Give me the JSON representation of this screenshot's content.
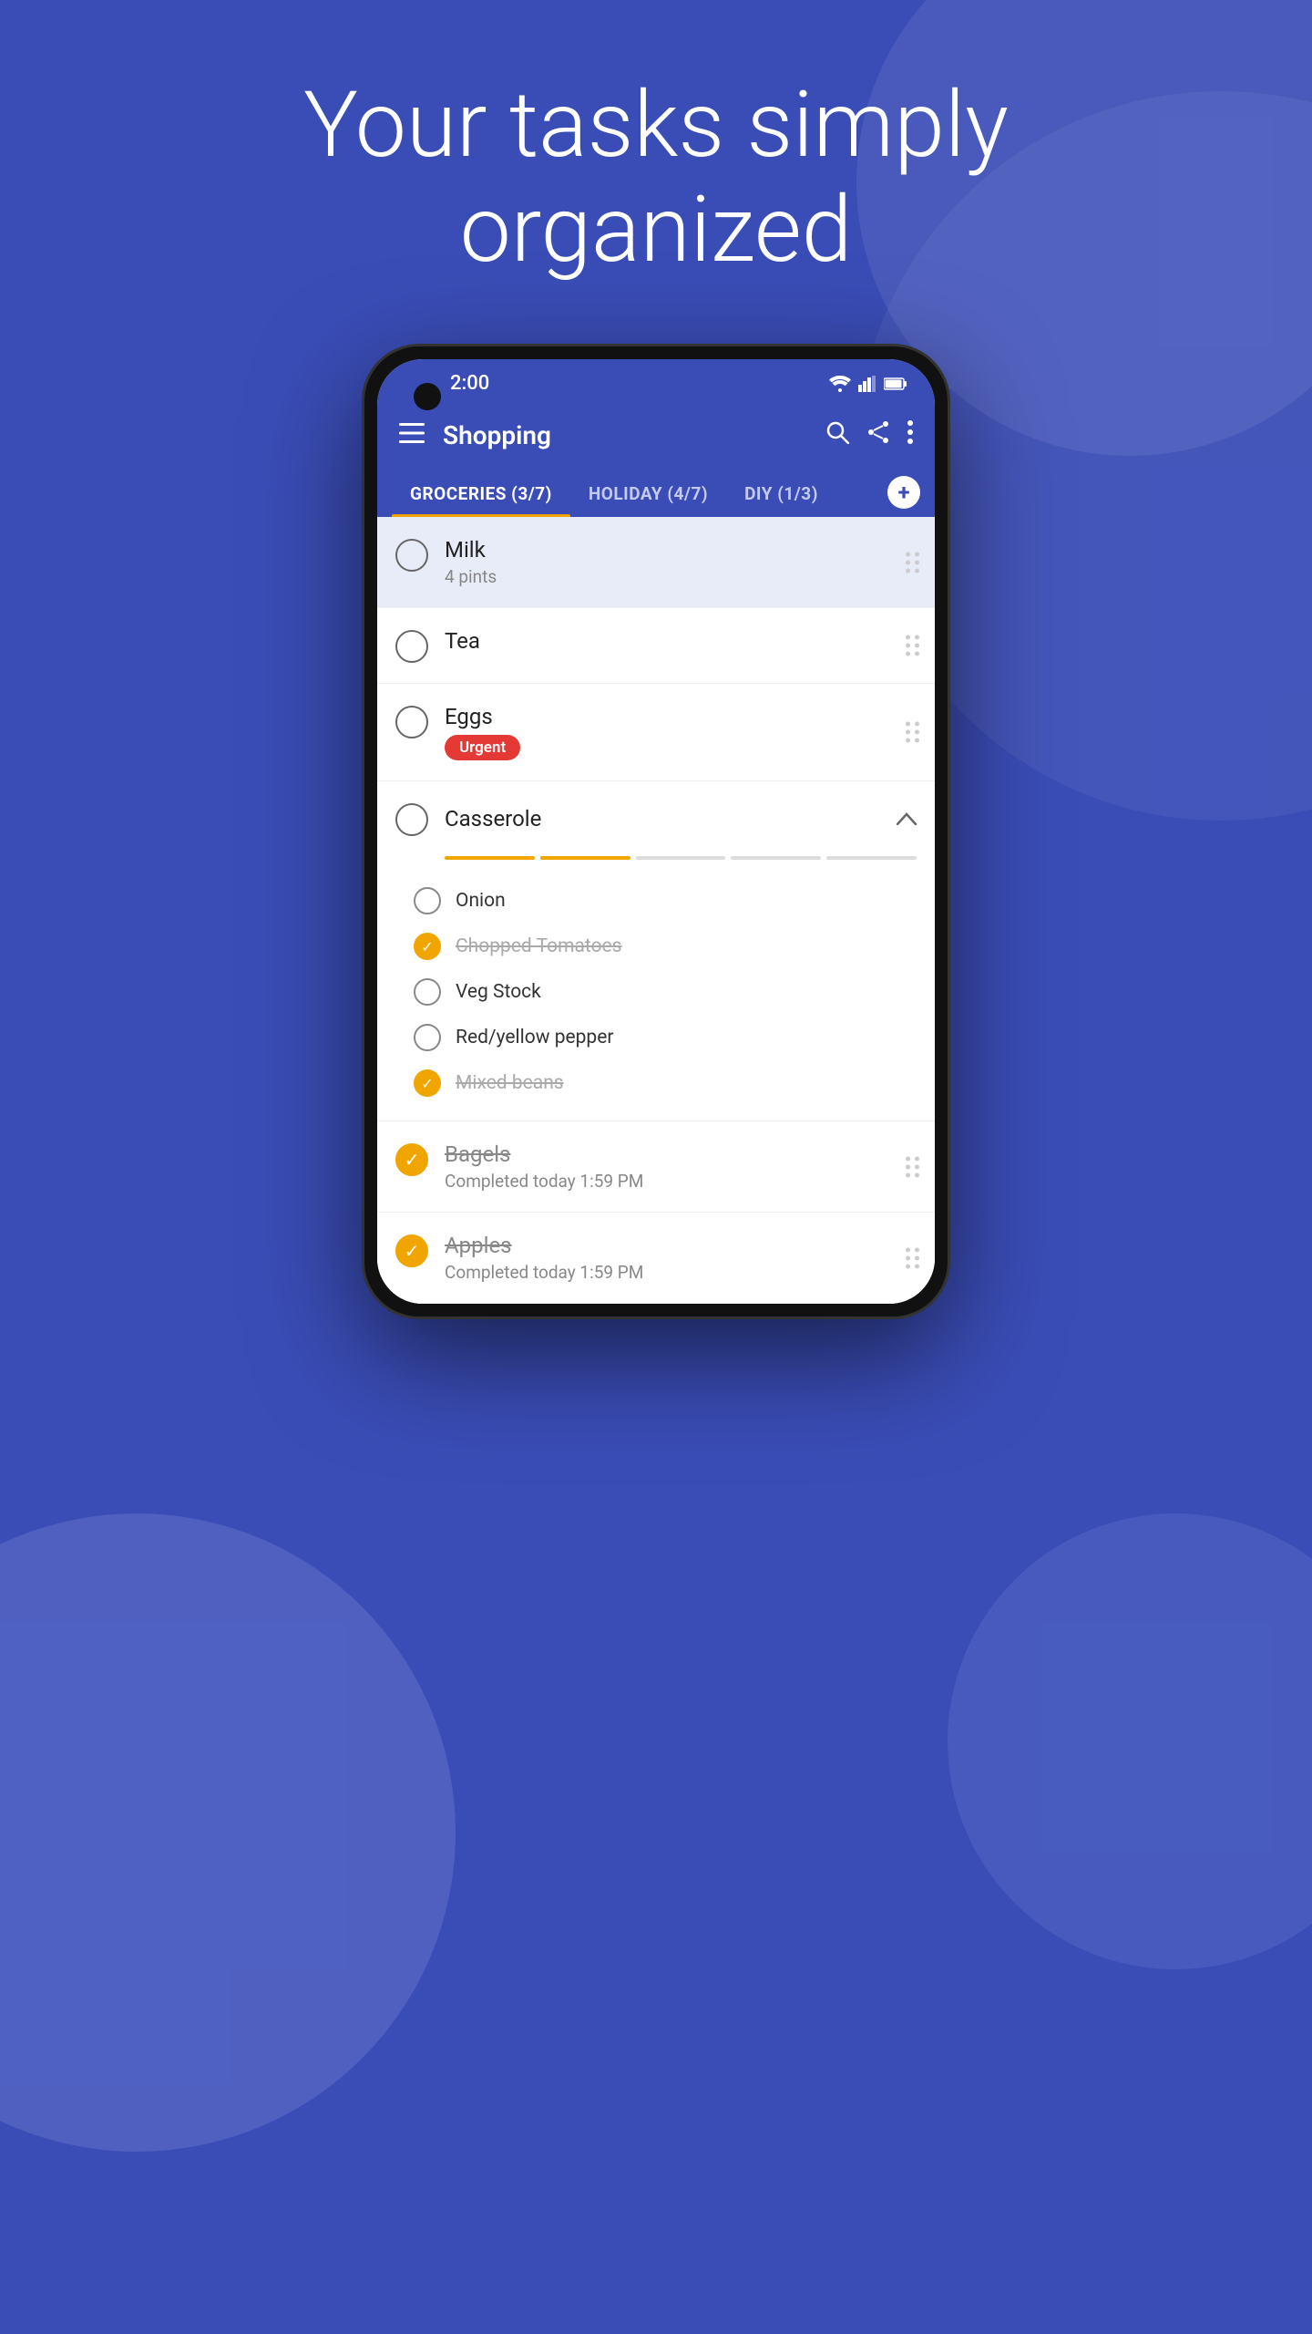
{
  "hero": {
    "line1": "Your tasks simply",
    "line2": "organized"
  },
  "phone": {
    "status_bar": {
      "time": "2:00",
      "wifi_icon": "wifi",
      "signal_icon": "signal",
      "battery_icon": "battery"
    },
    "toolbar": {
      "menu_icon": "hamburger",
      "title": "Shopping",
      "search_icon": "search",
      "share_icon": "share",
      "more_icon": "more-vertical"
    },
    "tabs": [
      {
        "label": "GROCERIES (3/7)",
        "active": true
      },
      {
        "label": "HOLIDAY (4/7)",
        "active": false
      },
      {
        "label": "DIY (1/3)",
        "active": false
      }
    ],
    "tab_add_label": "+",
    "list_items": [
      {
        "id": "milk",
        "title": "Milk",
        "subtitle": "4 pints",
        "checked": false,
        "urgent": false,
        "highlighted": true,
        "completed_text": null
      },
      {
        "id": "tea",
        "title": "Tea",
        "subtitle": null,
        "checked": false,
        "urgent": false,
        "highlighted": false,
        "completed_text": null
      },
      {
        "id": "eggs",
        "title": "Eggs",
        "subtitle": null,
        "badge": "Urgent",
        "checked": false,
        "urgent": true,
        "highlighted": false,
        "completed_text": null
      }
    ],
    "casserole": {
      "title": "Casserole",
      "checked": false,
      "progress": [
        true,
        true,
        false,
        false,
        false
      ],
      "sub_items": [
        {
          "title": "Onion",
          "checked": false
        },
        {
          "title": "Chopped Tomatoes",
          "checked": true
        },
        {
          "title": "Veg Stock",
          "checked": false
        },
        {
          "title": "Red/yellow pepper",
          "checked": false
        },
        {
          "title": "Mixed beans",
          "checked": true
        }
      ]
    },
    "completed_items": [
      {
        "id": "bagels",
        "title": "Bagels",
        "completed_text": "Completed today 1:59 PM"
      },
      {
        "id": "apples",
        "title": "Apples",
        "completed_text": "Completed today 1:59 PM"
      }
    ]
  }
}
